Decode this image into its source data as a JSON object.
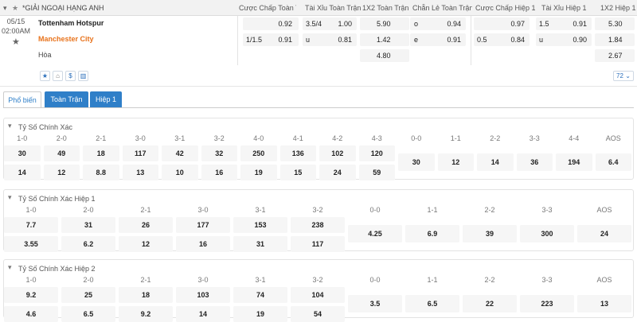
{
  "header": {
    "league": "*GIẢI NGOẠI HẠNG ANH",
    "columns": [
      "Cược Chấp Toàn T...",
      "Tài Xỉu Toàn Trận",
      "1X2 Toàn Trận",
      "Chẵn Lẻ Toàn Trận",
      "Cược Chấp Hiệp 1",
      "Tài Xỉu Hiệp 1",
      "1X2 Hiệp 1"
    ]
  },
  "match": {
    "date": "05/15",
    "time": "02:00AM",
    "home": "Tottenham Hotspur",
    "away": "Manchester City",
    "draw": "Hòa",
    "more_count": "72",
    "row1": {
      "hdp_val": "0.92",
      "ou_line": "3.5/4",
      "ou_val": "1.00",
      "x12": "5.90",
      "oe_lbl": "o",
      "oe_val": "0.94",
      "h1hdp": "0.97",
      "h1ou_line": "1.5",
      "h1ou_val": "0.91",
      "h1x12": "5.30"
    },
    "row2": {
      "hdp_line": "1/1.5",
      "hdp_val": "0.91",
      "ou_lbl": "u",
      "ou_val": "0.81",
      "x12": "1.42",
      "oe_lbl": "e",
      "oe_val": "0.91",
      "h1hdp_line": "0.5",
      "h1hdp": "0.84",
      "h1ou_lbl": "u",
      "h1ou_val": "0.90",
      "h1x12": "1.84"
    },
    "row3": {
      "x12": "4.80",
      "h1x12": "2.67"
    }
  },
  "tabs": [
    "Phổ biến",
    "Toàn Trận",
    "Hiệp 1"
  ],
  "sections": [
    {
      "title": "Tỷ Số Chính Xác",
      "labels": [
        "1-0",
        "2-0",
        "2-1",
        "3-0",
        "3-1",
        "3-2",
        "4-0",
        "4-1",
        "4-2",
        "4-3",
        "0-0",
        "1-1",
        "2-2",
        "3-3",
        "4-4",
        "AOS"
      ],
      "row1": [
        "30",
        "49",
        "18",
        "117",
        "42",
        "32",
        "250",
        "136",
        "102",
        "120"
      ],
      "row2": [
        "14",
        "12",
        "8.8",
        "13",
        "10",
        "16",
        "19",
        "15",
        "24",
        "59"
      ],
      "mid": [
        "30",
        "12",
        "14",
        "36",
        "194",
        "6.4"
      ]
    },
    {
      "title": "Tỷ Số Chính Xác Hiệp 1",
      "labels": [
        "1-0",
        "2-0",
        "2-1",
        "3-0",
        "3-1",
        "3-2",
        "0-0",
        "1-1",
        "2-2",
        "3-3",
        "AOS"
      ],
      "row1": [
        "7.7",
        "31",
        "26",
        "177",
        "153",
        "238"
      ],
      "row2": [
        "3.55",
        "6.2",
        "12",
        "16",
        "31",
        "117"
      ],
      "mid": [
        "4.25",
        "6.9",
        "39",
        "300",
        "24"
      ]
    },
    {
      "title": "Tỷ Số Chính Xác Hiệp 2",
      "labels": [
        "1-0",
        "2-0",
        "2-1",
        "3-0",
        "3-1",
        "3-2",
        "0-0",
        "1-1",
        "2-2",
        "3-3",
        "AOS"
      ],
      "row1": [
        "9.2",
        "25",
        "18",
        "103",
        "74",
        "104"
      ],
      "row2": [
        "4.6",
        "6.5",
        "9.2",
        "14",
        "19",
        "54"
      ],
      "mid": [
        "3.5",
        "6.5",
        "22",
        "223",
        "13"
      ]
    }
  ],
  "colors": {
    "accent": "#2f7fc8",
    "away_team": "#e8731c"
  }
}
